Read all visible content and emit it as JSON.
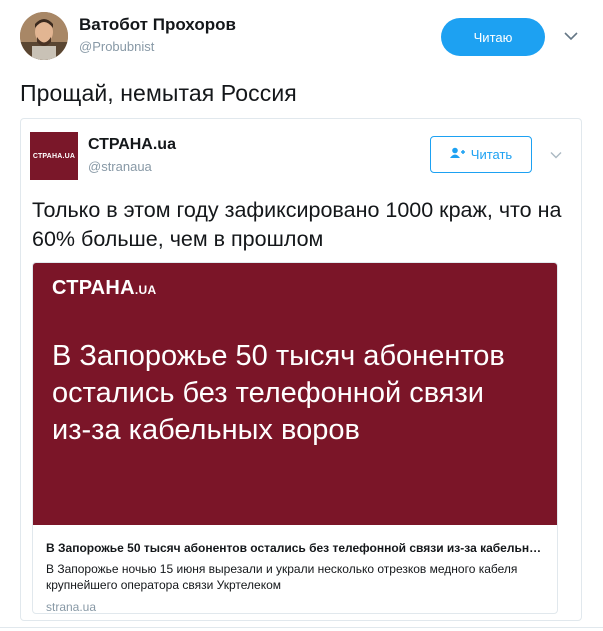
{
  "author": {
    "name": "Ватобот Прохоров",
    "handle": "@Probubnist",
    "follow_label": "Читаю"
  },
  "tweet": {
    "text": "Прощай, немытая Россия"
  },
  "quoted": {
    "logo_text": "СТРАНА.UA",
    "name": "СТРАНА.ua",
    "handle": "@stranaua",
    "follow_label": "Читать",
    "text": "Только в этом году зафиксировано 1000 краж, что на 60% больше, чем в прошлом",
    "card": {
      "image_logo": "СТРАНА",
      "image_logo_suffix": ".UA",
      "image_headline": "В Запорожье 50 тысяч абонентов остались без телефонной связи из-за кабельных воров",
      "title": "В Запорожье 50 тысяч абонентов остались без телефонной связи из-за кабельных воров",
      "description": "В Запорожье ночью 15 июня вырезали и украли несколько отрезков медного кабеля крупнейшего оператора связи Укртелеком",
      "domain": "strana.ua"
    }
  },
  "colors": {
    "brand_blue": "#1da1f2",
    "strana_red": "#7b1528",
    "muted_text": "#8899a6"
  },
  "icons": {
    "caret": "chevron-down-icon",
    "follow": "add-user-icon"
  }
}
